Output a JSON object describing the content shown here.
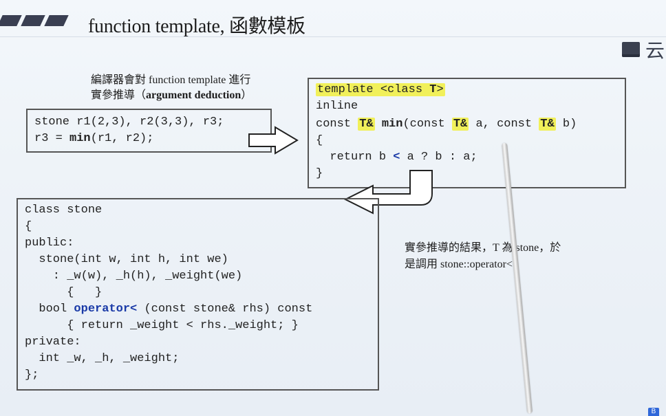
{
  "title": "function template, 函數模板",
  "brand_partial": "云",
  "note_top": {
    "line1": "編譯器會對 function template 進行",
    "line2_pre": "實參推導（",
    "line2_bold": "argument deduction",
    "line2_post": "）"
  },
  "call_box": {
    "line1": "stone r1(2,3), r2(3,3), r3;",
    "line2_pre": "r3 = ",
    "line2_bold": "min",
    "line2_post": "(r1, r2);"
  },
  "template_box": {
    "line1_pre": "template <class ",
    "line1_T": "T",
    "line1_post": ">",
    "line2": "inline",
    "line3_const": "const ",
    "line3_T1": "T&",
    "line3_min": "min",
    "line3_mid1": "(const ",
    "line3_T2": "T&",
    "line3_mid2": " a, const ",
    "line3_T3": "T&",
    "line3_end": " b)",
    "line4": "{",
    "line5_pre": "  return b ",
    "line5_lt": "<",
    "line5_post": " a ? b : a;",
    "line6": "}"
  },
  "class_box": {
    "lines": [
      "class stone",
      "{",
      "public:",
      "  stone(int w, int h, int we)",
      "    : _w(w), _h(h), _weight(we)",
      "      {   }",
      "  bool ",
      "      { return _weight < rhs._weight; }",
      "private:",
      "  int _w, _h, _weight;",
      "};"
    ],
    "operator_kw": "operator<",
    "operator_rest": " (const stone& rhs) const"
  },
  "note_bottom": {
    "line1": "實參推導的結果，T 為 stone，於",
    "line2": "是調用 stone::operator<"
  },
  "badge": "B"
}
